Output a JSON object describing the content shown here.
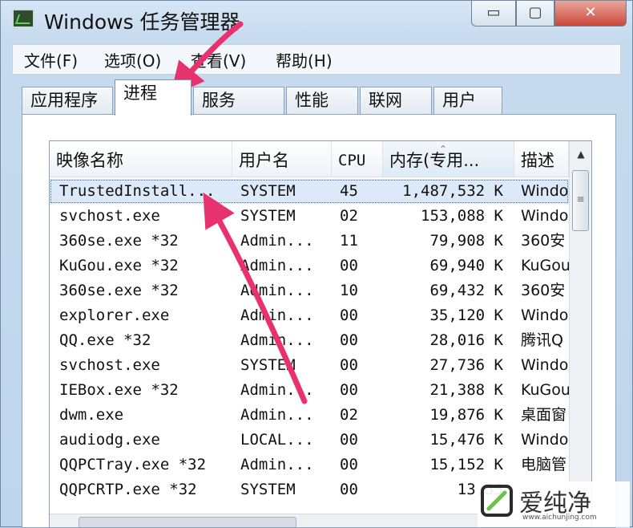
{
  "window": {
    "title": "Windows 任务管理器",
    "controls": {
      "minimize": "▭",
      "maximize": "▢",
      "close": "✕"
    }
  },
  "menu": [
    {
      "label": "文件(F)"
    },
    {
      "label": "选项(O)"
    },
    {
      "label": "查看(V)"
    },
    {
      "label": "帮助(H)"
    }
  ],
  "tabs": [
    {
      "label": "应用程序"
    },
    {
      "label": "进程",
      "active": true
    },
    {
      "label": "服务"
    },
    {
      "label": "性能"
    },
    {
      "label": "联网"
    },
    {
      "label": "用户"
    }
  ],
  "columns": {
    "name": "映像名称",
    "user": "用户名",
    "cpu": "CPU",
    "memory": "内存(专用...",
    "description": "描述"
  },
  "processes": [
    {
      "name": "TrustedInstall...",
      "user": "SYSTEM",
      "cpu": "45",
      "memory": "1,487,532 K",
      "description": "Windo",
      "selected": true
    },
    {
      "name": "svchost.exe",
      "user": "SYSTEM",
      "cpu": "02",
      "memory": "153,088 K",
      "description": "Windo"
    },
    {
      "name": "360se.exe *32",
      "user": "Admin...",
      "cpu": "11",
      "memory": "79,908 K",
      "description": "360安"
    },
    {
      "name": "KuGou.exe *32",
      "user": "Admin...",
      "cpu": "00",
      "memory": "69,940 K",
      "description": "KuGou"
    },
    {
      "name": "360se.exe *32",
      "user": "Admin...",
      "cpu": "10",
      "memory": "69,432 K",
      "description": "360安"
    },
    {
      "name": "explorer.exe",
      "user": "Admin...",
      "cpu": "00",
      "memory": "35,120 K",
      "description": "Windo"
    },
    {
      "name": "QQ.exe *32",
      "user": "Admin...",
      "cpu": "00",
      "memory": "28,016 K",
      "description": "腾讯Q"
    },
    {
      "name": "svchost.exe",
      "user": "SYSTEM",
      "cpu": "00",
      "memory": "27,736 K",
      "description": "Windo"
    },
    {
      "name": "IEBox.exe *32",
      "user": "Admin...",
      "cpu": "00",
      "memory": "21,388 K",
      "description": "KuGou"
    },
    {
      "name": "dwm.exe",
      "user": "Admin...",
      "cpu": "02",
      "memory": "19,876 K",
      "description": "桌面窗"
    },
    {
      "name": "audiodg.exe",
      "user": "LOCAL...",
      "cpu": "00",
      "memory": "15,476 K",
      "description": "Windo"
    },
    {
      "name": "QQPCTray.exe *32",
      "user": "Admin...",
      "cpu": "00",
      "memory": "15,152 K",
      "description": "电脑管"
    },
    {
      "name": "QQPCRTP.exe *32",
      "user": "SYSTEM",
      "cpu": "00",
      "memory": "13,55",
      "description": ""
    }
  ],
  "watermark": {
    "text": "爱纯净",
    "url": "www.aichunjing.com"
  },
  "colors": {
    "arrow": "#e8316f",
    "selection": "#dbe9f8",
    "titlebar": "#d7e6f5",
    "close_button": "#c9483a"
  }
}
